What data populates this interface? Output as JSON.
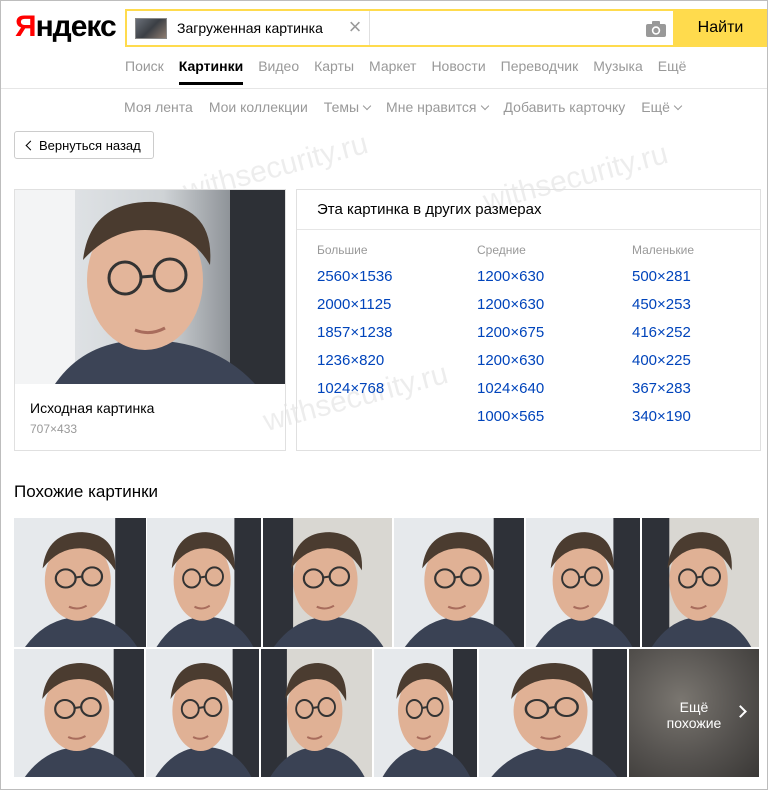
{
  "header": {
    "logo_first": "Я",
    "logo_rest": "ндекс",
    "search_chip_label": "Загруженная картинка",
    "search_button": "Найти",
    "services": [
      {
        "label": "Поиск",
        "active": false
      },
      {
        "label": "Картинки",
        "active": true
      },
      {
        "label": "Видео",
        "active": false
      },
      {
        "label": "Карты",
        "active": false
      },
      {
        "label": "Маркет",
        "active": false
      },
      {
        "label": "Новости",
        "active": false
      },
      {
        "label": "Переводчик",
        "active": false
      },
      {
        "label": "Музыка",
        "active": false
      },
      {
        "label": "Ещё",
        "active": false
      }
    ]
  },
  "subnav": {
    "items": [
      "Моя лента",
      "Мои коллекции",
      "Темы",
      "Мне нравится",
      "Добавить карточку",
      "Ещё"
    ]
  },
  "back_button": "Вернуться назад",
  "original": {
    "title": "Исходная картинка",
    "size": "707×433"
  },
  "sizes": {
    "title": "Эта картинка в других размерах",
    "columns": [
      {
        "heading": "Большие",
        "items": [
          "2560×1536",
          "2000×1125",
          "1857×1238",
          "1236×820",
          "1024×768"
        ]
      },
      {
        "heading": "Средние",
        "items": [
          "1200×630",
          "1200×630",
          "1200×675",
          "1200×630",
          "1024×640",
          "1000×565"
        ]
      },
      {
        "heading": "Маленькие",
        "items": [
          "500×281",
          "450×253",
          "416×252",
          "400×225",
          "367×283",
          "340×190"
        ]
      }
    ]
  },
  "watermark": "withsecurity.ru",
  "similar": {
    "title": "Похожие картинки",
    "more_line1": "Ещё",
    "more_line2": "похожие"
  },
  "colors": {
    "link": "#0044bb",
    "accent_yellow": "#ffdb4d",
    "logo_red": "#ff0000",
    "muted_gray": "#999999"
  }
}
